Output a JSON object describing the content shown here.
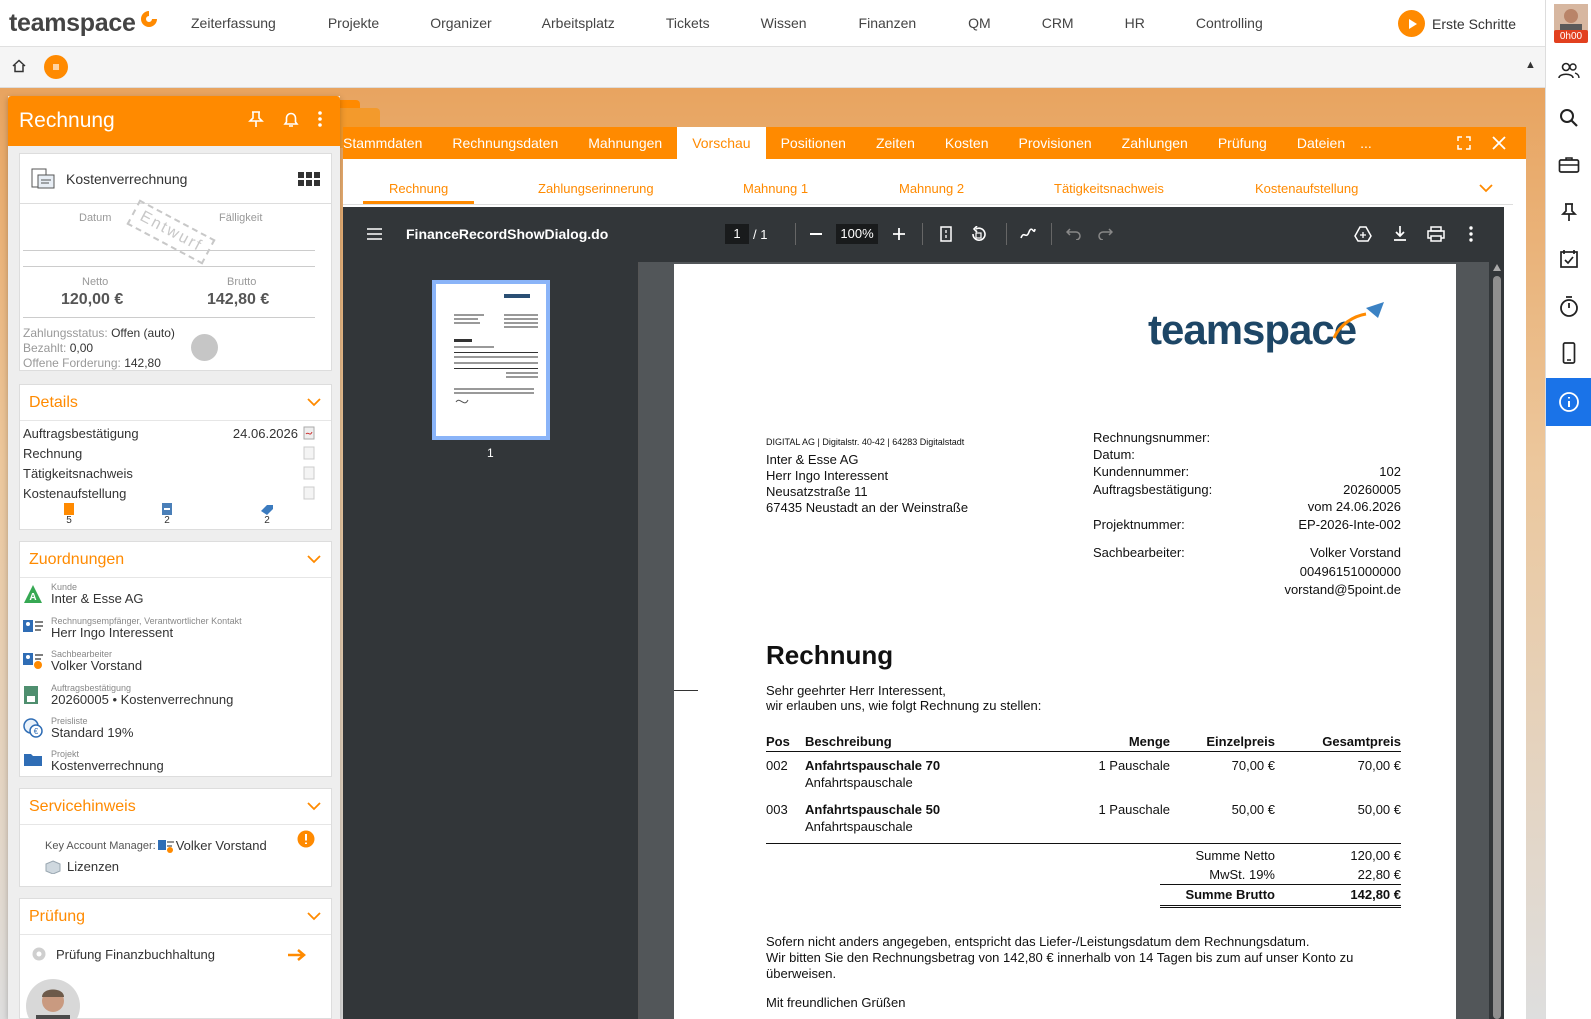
{
  "topnav": {
    "logo": "teamspace",
    "items": [
      "Zeiterfassung",
      "Projekte",
      "Organizer",
      "Arbeitsplatz",
      "Tickets",
      "Wissen",
      "Finanzen",
      "QM",
      "CRM",
      "HR",
      "Controlling"
    ],
    "erste_schritte": "Erste Schritte",
    "timer": "0h00"
  },
  "secondbar": {
    "up_arrow": "▲"
  },
  "left": {
    "title": "Rechnung",
    "doc_type": "Kostenverrechnung",
    "datum_label": "Datum",
    "faelligkeit_label": "Fälligkeit",
    "stamp": "Entwurf",
    "netto_label": "Netto",
    "netto_value": "120,00 €",
    "brutto_label": "Brutto",
    "brutto_value": "142,80 €",
    "zahlungsstatus_label": "Zahlungsstatus:",
    "zahlungsstatus_value": "Offen (auto)",
    "bezahlt_label": "Bezahlt:",
    "bezahlt_value": "0,00",
    "offene_label": "Offene Forderung:",
    "offene_value": "142,80",
    "details": {
      "title": "Details",
      "rows": [
        {
          "label": "Auftragsbestätigung",
          "value": "24.06.2026"
        },
        {
          "label": "Rechnung",
          "value": ""
        },
        {
          "label": "Tätigkeitsnachweis",
          "value": ""
        },
        {
          "label": "Kostenaufstellung",
          "value": ""
        }
      ],
      "counts": [
        "5",
        "2",
        "2"
      ]
    },
    "zuordnungen": {
      "title": "Zuordnungen",
      "items": [
        {
          "label": "Kunde",
          "value": "Inter & Esse AG"
        },
        {
          "label": "Rechnungsempfänger, Verantwortlicher Kontakt",
          "value": "Herr Ingo Interessent"
        },
        {
          "label": "Sachbearbeiter",
          "value": "Volker Vorstand"
        },
        {
          "label": "Auftragsbestätigung",
          "value": "20260005 • Kostenverrechnung"
        },
        {
          "label": "Preisliste",
          "value": "Standard 19%"
        },
        {
          "label": "Projekt",
          "value": "Kostenverrechnung"
        }
      ]
    },
    "servicehinweis": {
      "title": "Servicehinweis",
      "kam_label": "Key Account Manager:",
      "kam_value": "Volker Vorstand",
      "lizenzen": "Lizenzen"
    },
    "pruefung": {
      "title": "Prüfung",
      "item": "Prüfung Finanzbuchhaltung"
    }
  },
  "tabs": [
    "Stammdaten",
    "Rechnungsdaten",
    "Mahnungen",
    "Vorschau",
    "Positionen",
    "Zeiten",
    "Kosten",
    "Provisionen",
    "Zahlungen",
    "Prüfung",
    "Dateien",
    "..."
  ],
  "subtabs": [
    "Rechnung",
    "Zahlungserinnerung",
    "Mahnung 1",
    "Mahnung 2",
    "Tätigkeitsnachweis",
    "Kostenaufstellung"
  ],
  "pdf": {
    "filename": "FinanceRecordShowDialog.do",
    "page_current": "1",
    "page_total": "/ 1",
    "zoom": "100%",
    "thumb_label": "1"
  },
  "invoice": {
    "logo": "teamspace",
    "sender_line": "DIGITAL AG | Digitalstr. 40-42 | 64283 Digitalstadt",
    "recipient": [
      "Inter & Esse AG",
      "Herr Ingo Interessent",
      "Neusatzstraße 11",
      "67435 Neustadt an der Weinstraße"
    ],
    "meta": [
      {
        "label": "Rechnungsnummer:",
        "value": ""
      },
      {
        "label": "Datum:",
        "value": ""
      },
      {
        "label": "Kundennummer:",
        "value": "102"
      },
      {
        "label": "Auftragsbestätigung:",
        "value": "20260005"
      },
      {
        "label": "",
        "value": "vom 24.06.2026"
      },
      {
        "label": "Projektnummer:",
        "value": "EP-2026-Inte-002"
      },
      {
        "label": "Sachbearbeiter:",
        "value": "Volker Vorstand"
      },
      {
        "label": "",
        "value": "00496151000000"
      },
      {
        "label": "",
        "value": "vorstand@5point.de"
      }
    ],
    "title": "Rechnung",
    "greeting": "Sehr geehrter Herr Interessent,",
    "intro": "wir erlauben uns, wie folgt Rechnung zu stellen:",
    "columns": [
      "Pos",
      "Beschreibung",
      "Menge",
      "Einzelpreis",
      "Gesamtpreis"
    ],
    "positions": [
      {
        "pos": "002",
        "title": "Anfahrtspauschale 70",
        "sub": "Anfahrtspauschale",
        "menge": "1 Pauschale",
        "einzel": "70,00 €",
        "gesamt": "70,00 €"
      },
      {
        "pos": "003",
        "title": "Anfahrtspauschale 50",
        "sub": "Anfahrtspauschale",
        "menge": "1 Pauschale",
        "einzel": "50,00 €",
        "gesamt": "50,00 €"
      }
    ],
    "summe_netto_label": "Summe Netto",
    "summe_netto": "120,00 €",
    "mwst_label": "MwSt. 19%",
    "mwst": "22,80 €",
    "summe_brutto_label": "Summe Brutto",
    "summe_brutto": "142,80 €",
    "footer1": "Sofern nicht anders angegeben, entspricht das Liefer-/Leistungsdatum dem Rechnungsdatum.",
    "footer2": "Wir bitten Sie den Rechnungsbetrag von 142,80 € innerhalb von 14 Tagen bis zum auf unser Konto zu",
    "footer3": "überweisen.",
    "closing": "Mit freundlichen Grüßen"
  }
}
